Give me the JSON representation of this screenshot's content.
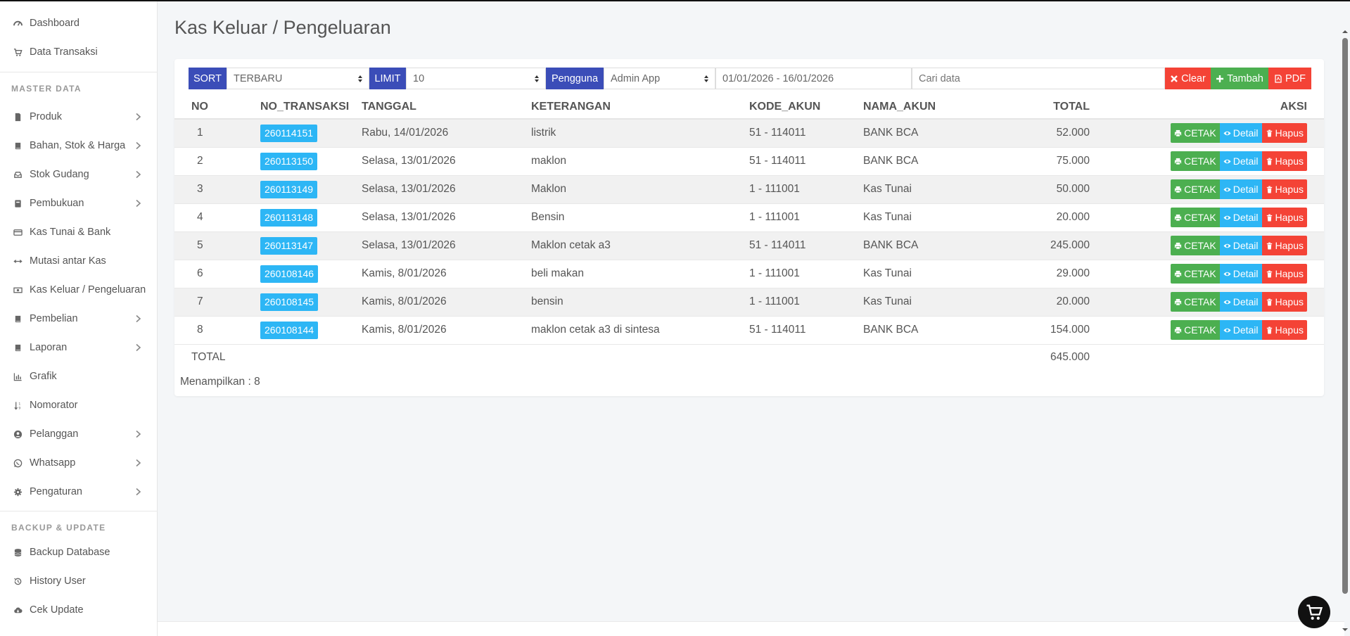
{
  "sidebar": {
    "items": [
      {
        "label": "Dashboard",
        "icon": "dashboard-icon",
        "has_sub": false
      },
      {
        "label": "Data Transaksi",
        "icon": "cart-icon",
        "has_sub": false
      },
      {
        "label": "Produk",
        "icon": "file-icon",
        "has_sub": true
      },
      {
        "label": "Bahan, Stok & Harga",
        "icon": "book-icon",
        "has_sub": true
      },
      {
        "label": "Stok Gudang",
        "icon": "inbox-icon",
        "has_sub": true
      },
      {
        "label": "Pembukuan",
        "icon": "ledger-icon",
        "has_sub": true
      },
      {
        "label": "Kas Tunai & Bank",
        "icon": "credit-card-icon",
        "has_sub": false
      },
      {
        "label": "Mutasi antar Kas",
        "icon": "arrows-horizontal-icon",
        "has_sub": false
      },
      {
        "label": "Kas Keluar / Pengeluaran",
        "icon": "money-icon",
        "has_sub": false
      },
      {
        "label": "Pembelian",
        "icon": "book-icon",
        "has_sub": true
      },
      {
        "label": "Laporan",
        "icon": "book-icon",
        "has_sub": true
      },
      {
        "label": "Grafik",
        "icon": "bar-chart-icon",
        "has_sub": false
      },
      {
        "label": "Nomorator",
        "icon": "sort-numeric-icon",
        "has_sub": false
      },
      {
        "label": "Pelanggan",
        "icon": "user-circle-icon",
        "has_sub": true
      },
      {
        "label": "Whatsapp",
        "icon": "whatsapp-icon",
        "has_sub": true
      },
      {
        "label": "Pengaturan",
        "icon": "gear-icon",
        "has_sub": true
      }
    ],
    "section_master": "MASTER DATA",
    "section_backup": "BACKUP & UPDATE",
    "backup_items": [
      {
        "label": "Backup Database",
        "icon": "database-icon"
      },
      {
        "label": "History User",
        "icon": "history-icon"
      },
      {
        "label": "Cek Update",
        "icon": "cloud-download-icon"
      }
    ]
  },
  "page": {
    "title": "Kas Keluar / Pengeluaran"
  },
  "toolbar": {
    "sort_label": "SORT",
    "sort_value": "TERBARU",
    "limit_label": "LIMIT",
    "limit_value": "10",
    "user_label": "Pengguna",
    "user_value": "Admin App",
    "date_range": "01/01/2026 - 16/01/2026",
    "search_placeholder": "Cari data",
    "clear_label": "Clear",
    "add_label": "Tambah",
    "pdf_label": "PDF"
  },
  "table": {
    "headers": [
      "NO",
      "NO_TRANSAKSI",
      "TANGGAL",
      "KETERANGAN",
      "KODE_AKUN",
      "NAMA_AKUN",
      "TOTAL",
      "AKSI"
    ],
    "rows": [
      {
        "no": "1",
        "trx": "260114151",
        "tanggal": "Rabu, 14/01/2026",
        "keterangan": "listrik",
        "kode": "51 - 114011",
        "nama": "BANK BCA",
        "total": "52.000"
      },
      {
        "no": "2",
        "trx": "260113150",
        "tanggal": "Selasa, 13/01/2026",
        "keterangan": "maklon",
        "kode": "51 - 114011",
        "nama": "BANK BCA",
        "total": "75.000"
      },
      {
        "no": "3",
        "trx": "260113149",
        "tanggal": "Selasa, 13/01/2026",
        "keterangan": "Maklon",
        "kode": "1 - 111001",
        "nama": "Kas Tunai",
        "total": "50.000"
      },
      {
        "no": "4",
        "trx": "260113148",
        "tanggal": "Selasa, 13/01/2026",
        "keterangan": "Bensin",
        "kode": "1 - 111001",
        "nama": "Kas Tunai",
        "total": "20.000"
      },
      {
        "no": "5",
        "trx": "260113147",
        "tanggal": "Selasa, 13/01/2026",
        "keterangan": "Maklon cetak a3",
        "kode": "51 - 114011",
        "nama": "BANK BCA",
        "total": "245.000"
      },
      {
        "no": "6",
        "trx": "260108146",
        "tanggal": "Kamis, 8/01/2026",
        "keterangan": "beli makan",
        "kode": "1 - 111001",
        "nama": "Kas Tunai",
        "total": "29.000"
      },
      {
        "no": "7",
        "trx": "260108145",
        "tanggal": "Kamis, 8/01/2026",
        "keterangan": "bensin",
        "kode": "1 - 111001",
        "nama": "Kas Tunai",
        "total": "20.000"
      },
      {
        "no": "8",
        "trx": "260108144",
        "tanggal": "Kamis, 8/01/2026",
        "keterangan": "maklon cetak a3 di sintesa",
        "kode": "51 - 114011",
        "nama": "BANK BCA",
        "total": "154.000"
      }
    ],
    "actions": {
      "print": "CETAK",
      "detail": "Detail",
      "delete": "Hapus"
    },
    "total_label": "TOTAL",
    "total_value": "645.000"
  },
  "footer": {
    "showing": "Menampilkan : 8"
  },
  "colors": {
    "primary": "#3b4db8",
    "success": "#4caf50",
    "info": "#2db6f5",
    "danger": "#f44336"
  }
}
